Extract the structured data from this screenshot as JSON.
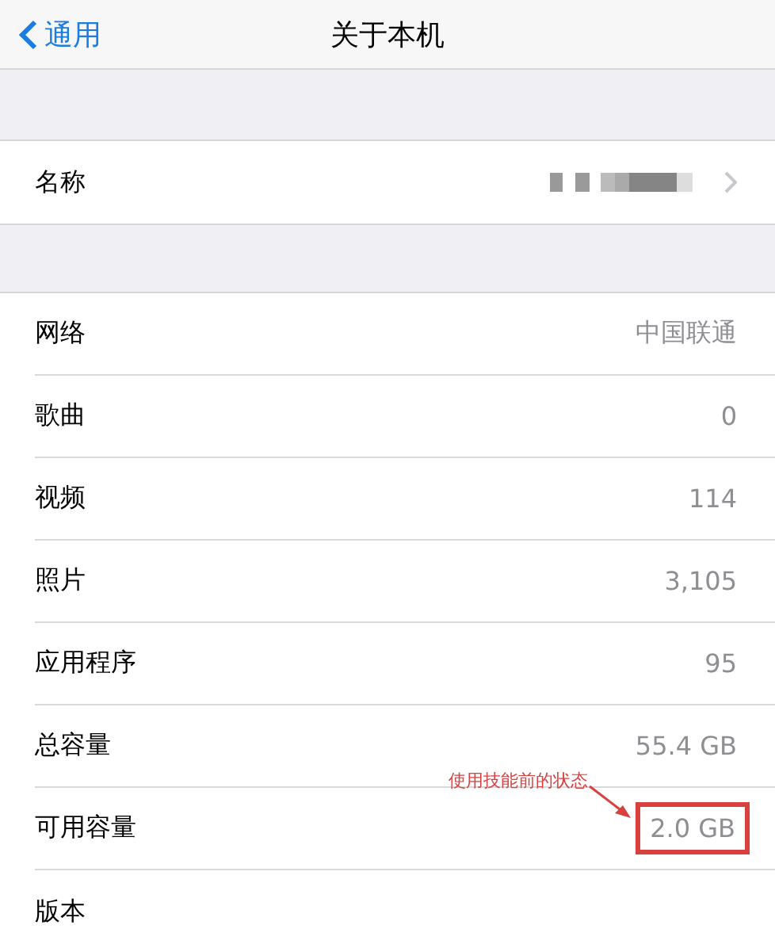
{
  "nav": {
    "back": "通用",
    "title": "关于本机"
  },
  "name_row": {
    "label": "名称"
  },
  "rows": [
    {
      "label": "网络",
      "value": "中国联通",
      "highlighted": false
    },
    {
      "label": "歌曲",
      "value": "0",
      "highlighted": false
    },
    {
      "label": "视频",
      "value": "114",
      "highlighted": false
    },
    {
      "label": "照片",
      "value": "3,105",
      "highlighted": false
    },
    {
      "label": "应用程序",
      "value": "95",
      "highlighted": false
    },
    {
      "label": "总容量",
      "value": "55.4 GB",
      "highlighted": false
    },
    {
      "label": "可用容量",
      "value": "2.0 GB",
      "highlighted": true,
      "annotation": "使用技能前的状态"
    },
    {
      "label": "版本",
      "highlighted": false
    }
  ]
}
